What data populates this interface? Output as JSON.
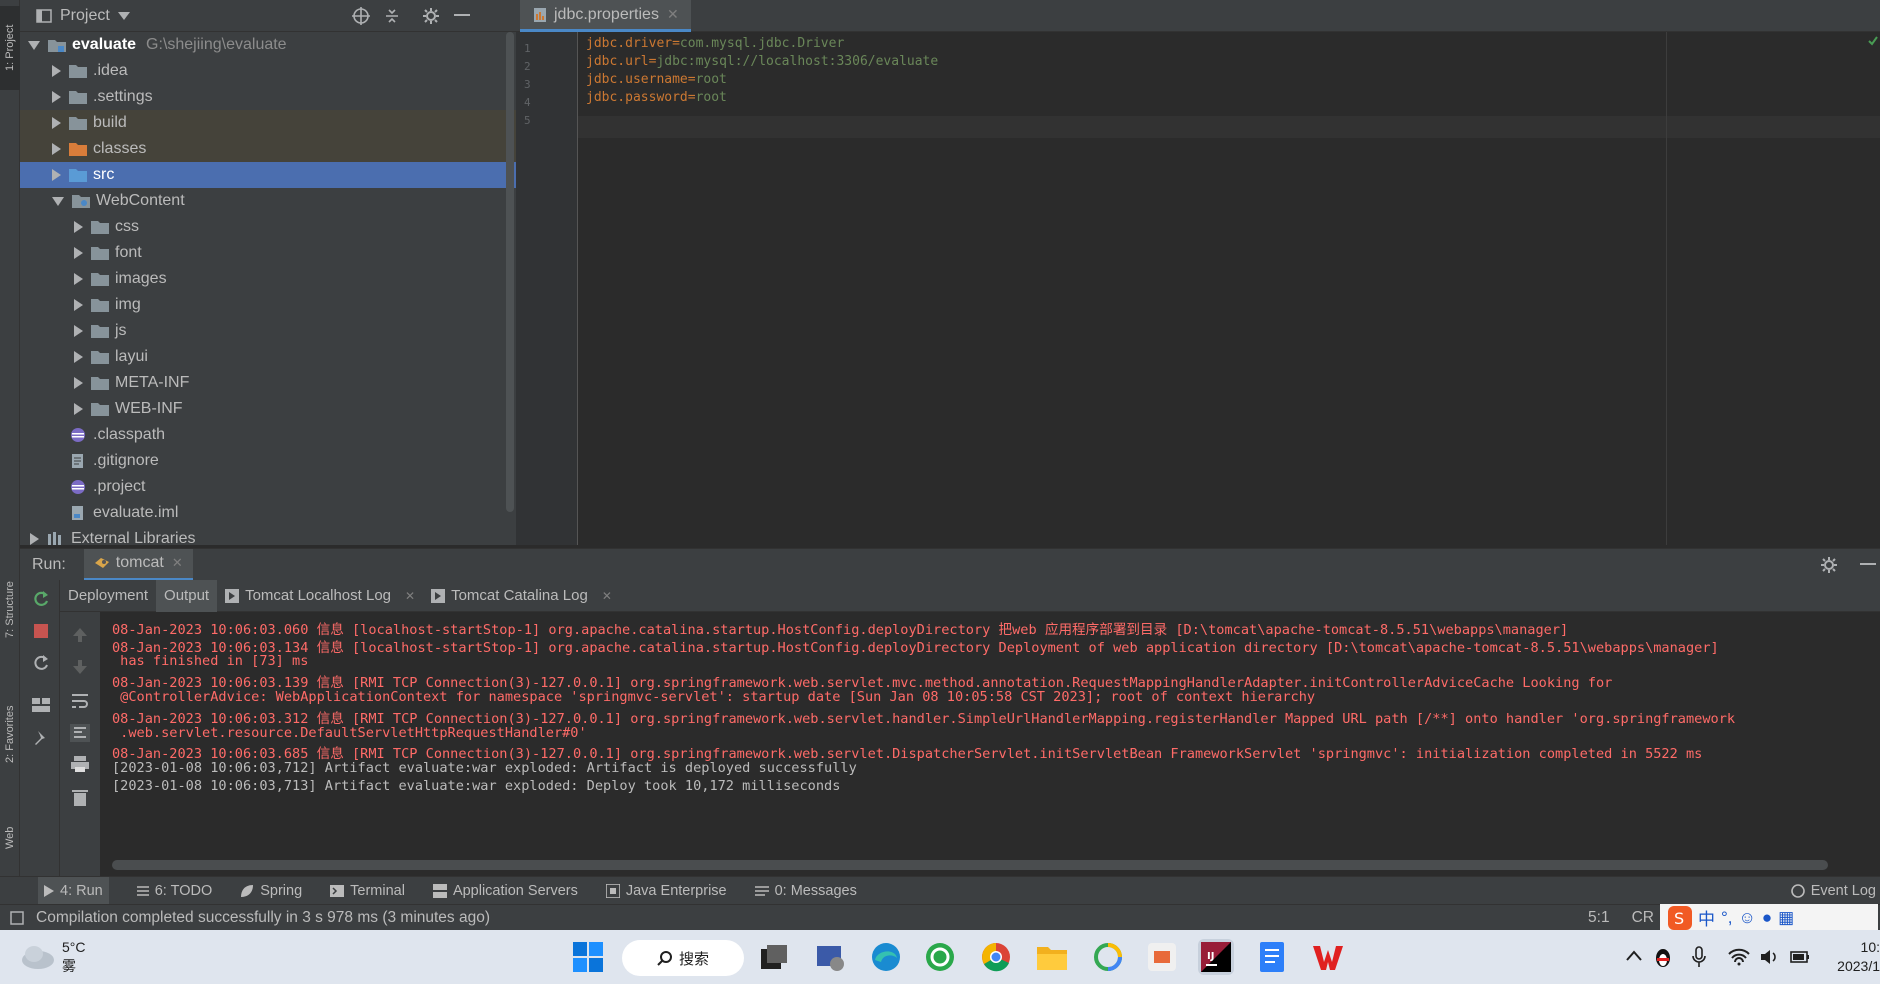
{
  "left_strip": {
    "project_tab": "1: Project",
    "structure_tab": "7: Structure",
    "favorites_tab": "2: Favorites",
    "web_tab": "Web"
  },
  "project": {
    "title": "Project",
    "root": {
      "name": "evaluate",
      "path": "G:\\shejiing\\evaluate"
    },
    "items": [
      {
        "label": ".idea"
      },
      {
        "label": ".settings"
      },
      {
        "label": "build"
      },
      {
        "label": "classes"
      },
      {
        "label": "src"
      },
      {
        "label": "WebContent"
      },
      {
        "label": "css"
      },
      {
        "label": "font"
      },
      {
        "label": "images"
      },
      {
        "label": "img"
      },
      {
        "label": "js"
      },
      {
        "label": "layui"
      },
      {
        "label": "META-INF"
      },
      {
        "label": "WEB-INF"
      },
      {
        "label": ".classpath"
      },
      {
        "label": ".gitignore"
      },
      {
        "label": ".project"
      },
      {
        "label": "evaluate.iml"
      },
      {
        "label": "External Libraries"
      }
    ]
  },
  "editor": {
    "tab": "jdbc.properties",
    "lines": [
      {
        "n": "1",
        "key": "jdbc.driver=",
        "val": "com.mysql.jdbc.Driver"
      },
      {
        "n": "2",
        "key": "jdbc.url=",
        "val": "jdbc:mysql://localhost:3306/evaluate"
      },
      {
        "n": "3",
        "key": "jdbc.username=",
        "val": "root"
      },
      {
        "n": "4",
        "key": "jdbc.password=",
        "val": "root"
      },
      {
        "n": "5",
        "key": "",
        "val": ""
      }
    ]
  },
  "run": {
    "label": "Run:",
    "config": "tomcat",
    "subtabs": {
      "deployment": "Deployment",
      "output": "Output",
      "localhost_log": "Tomcat Localhost Log",
      "catalina_log": "Tomcat Catalina Log"
    },
    "log": [
      "08-Jan-2023 10:06:03.060 信息 [localhost-startStop-1] org.apache.catalina.startup.HostConfig.deployDirectory 把web 应用程序部署到目录 [D:\\tomcat\\apache-tomcat-8.5.51\\webapps\\manager]",
      "08-Jan-2023 10:06:03.134 信息 [localhost-startStop-1] org.apache.catalina.startup.HostConfig.deployDirectory Deployment of web application directory [D:\\tomcat\\apache-tomcat-8.5.51\\webapps\\manager]",
      " has finished in [73] ms",
      "08-Jan-2023 10:06:03.139 信息 [RMI TCP Connection(3)-127.0.0.1] org.springframework.web.servlet.mvc.method.annotation.RequestMappingHandlerAdapter.initControllerAdviceCache Looking for",
      " @ControllerAdvice: WebApplicationContext for namespace 'springmvc-servlet': startup date [Sun Jan 08 10:05:58 CST 2023]; root of context hierarchy",
      "08-Jan-2023 10:06:03.312 信息 [RMI TCP Connection(3)-127.0.0.1] org.springframework.web.servlet.handler.SimpleUrlHandlerMapping.registerHandler Mapped URL path [/**] onto handler 'org.springframework",
      " .web.servlet.resource.DefaultServletHttpRequestHandler#0'",
      "08-Jan-2023 10:06:03.685 信息 [RMI TCP Connection(3)-127.0.0.1] org.springframework.web.servlet.DispatcherServlet.initServletBean FrameworkServlet 'springmvc': initialization completed in 5522 ms",
      "[2023-01-08 10:06:03,712] Artifact evaluate:war exploded: Artifact is deployed successfully",
      "[2023-01-08 10:06:03,713] Artifact evaluate:war exploded: Deploy took 10,172 milliseconds"
    ]
  },
  "bottom_tools": {
    "run": "4: Run",
    "todo": "6: TODO",
    "spring": "Spring",
    "terminal": "Terminal",
    "app_servers": "Application Servers",
    "java_ee": "Java Enterprise",
    "messages": "0: Messages",
    "event_log": "Event Log"
  },
  "status": {
    "message": "Compilation completed successfully in 3 s 978 ms (3 minutes ago)",
    "position": "5:1",
    "line_sep": "CR"
  },
  "taskbar": {
    "temp": "5°C",
    "weather": "雾",
    "search": "搜索",
    "time": "10:",
    "date": "2023/1"
  },
  "colors": {
    "accent": "#4a88c7",
    "selection": "#4b6eaf",
    "log_red": "#ff6b68",
    "keyword": "#cc7832"
  }
}
